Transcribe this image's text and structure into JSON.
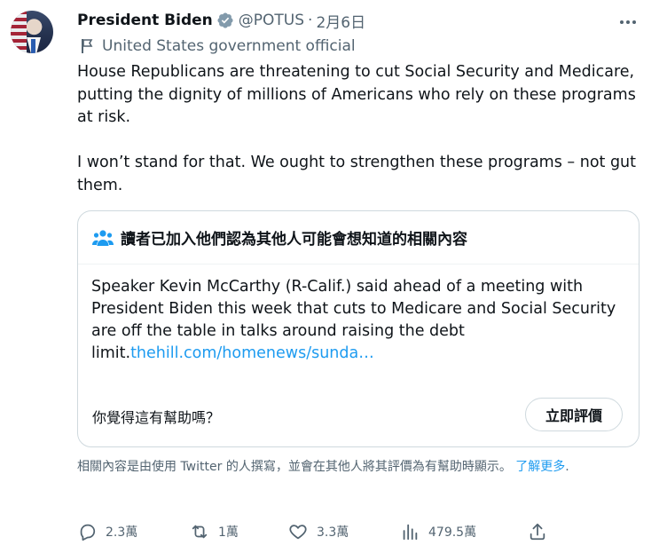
{
  "author": {
    "name": "President Biden",
    "handle": "@POTUS",
    "separator": "·",
    "date": "2月6日",
    "affiliation": "United States government official",
    "avatar_icon": "avatar"
  },
  "tweet": {
    "paragraph_1": "House Republicans are threatening to cut Social Security and Medicare, putting the dignity of millions of Americans who rely on these programs at risk.",
    "paragraph_2": "I won’t stand for that. We ought to strengthen these programs – not gut them."
  },
  "community_note": {
    "header": "讀者已加入他們認為其他人可能會想知道的相關內容",
    "body": "Speaker Kevin McCarthy (R-Calif.) said ahead of a meeting with President Biden this week that cuts to Medicare and Social Security are off the table in talks around raising the debt limit.",
    "link_text": "thehill.com/homenews/sunda…",
    "helpful_question": "你覺得這有幫助嗎？",
    "rate_button": "立即評價"
  },
  "disclaimer": {
    "text": "相關內容是由使用 Twitter 的人撰寫，並會在其他人將其評價為有幫助時顯示。 ",
    "learn_more": "了解更多",
    "period": "."
  },
  "actions": {
    "replies": "2.3萬",
    "retweets": "1萬",
    "likes": "3.3萬",
    "views": "479.5萬"
  },
  "colors": {
    "text": "#0f1419",
    "secondary": "#536471",
    "link": "#1d9bf0",
    "verified_badge": "#829aab",
    "border": "#cfd9de"
  }
}
